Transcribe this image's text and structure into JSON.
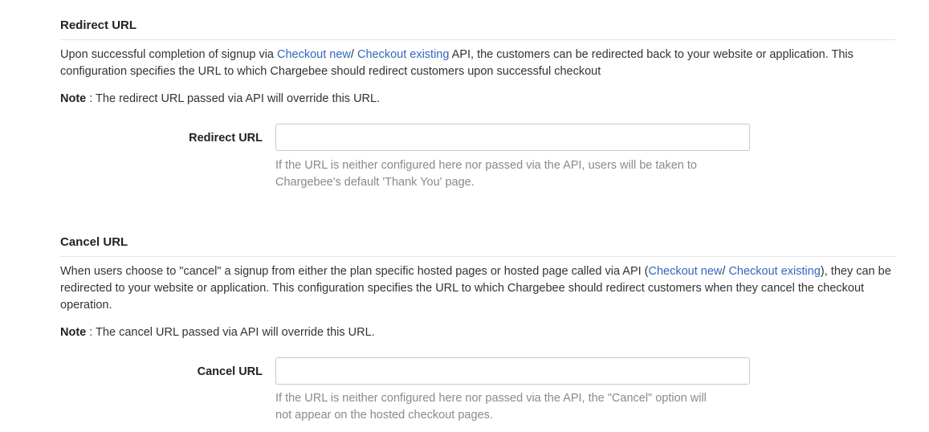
{
  "redirect": {
    "title": "Redirect URL",
    "desc_before": "Upon successful completion of signup via ",
    "link_checkout_new": "Checkout new",
    "desc_sep": "/ ",
    "link_checkout_existing": "Checkout existing",
    "desc_after": " API, the customers can be redirected back to your website or application. This configuration specifies the URL to which Chargebee should redirect customers upon successful checkout",
    "note_label": "Note",
    "note_text": " : The redirect URL passed via API will override this URL.",
    "field_label": "Redirect URL",
    "field_value": "",
    "field_placeholder": "",
    "help_text": "If the URL is neither configured here nor passed via the API, users will be taken to Chargebee's default 'Thank You' page."
  },
  "cancel": {
    "title": "Cancel URL",
    "desc_before": "When users choose to \"cancel\" a signup from either the plan specific hosted pages or hosted page called via API (",
    "link_checkout_new": "Checkout new",
    "desc_sep": "/ ",
    "link_checkout_existing": "Checkout existing",
    "desc_after": "), they can be redirected to your website or application. This configuration specifies the URL to which Chargebee should redirect customers when they cancel the checkout operation.",
    "note_label": "Note",
    "note_text": " : The cancel URL passed via API will override this URL.",
    "field_label": "Cancel URL",
    "field_value": "",
    "field_placeholder": "",
    "help_text": "If the URL is neither configured here nor passed via the API, the \"Cancel\" option will not appear on the hosted checkout pages."
  },
  "colors": {
    "link": "#3366bb",
    "text": "#333333",
    "help": "#8a8a8a",
    "divider": "#e4e4e4",
    "input_border": "#c8c8c8"
  }
}
